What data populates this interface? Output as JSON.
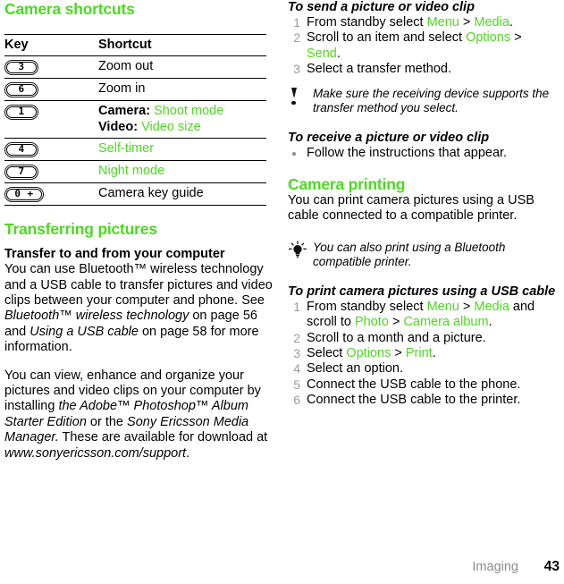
{
  "accent_color": "#4cd920",
  "left": {
    "section_title": "Camera shortcuts",
    "table": {
      "headers": [
        "Key",
        "Shortcut"
      ],
      "rows": [
        {
          "key": "3",
          "shortcut_plain": "Zoom out"
        },
        {
          "key": "6",
          "shortcut_plain": "Zoom in"
        },
        {
          "key": "1",
          "line1_label": "Camera:",
          "line1_value": "Shoot mode",
          "line2_label": "Video:",
          "line2_value": "Video size"
        },
        {
          "key": "4",
          "shortcut_green": "Self-timer"
        },
        {
          "key": "7",
          "shortcut_green": "Night mode"
        },
        {
          "key": "0 +",
          "shortcut_plain": "Camera key guide"
        }
      ]
    },
    "transferring": {
      "section_title": "Transferring pictures",
      "subheading": "Transfer to and from your computer",
      "para1_a": "You can use Bluetooth™ wireless technology and a USB cable to transfer pictures and video clips between your computer and phone. See ",
      "para1_ital1": "Bluetooth™ wireless technology",
      "para1_b": " on page 56 and ",
      "para1_ital2": "Using a USB cable",
      "para1_c": " on page 58 for more information.",
      "para2_a": "You can view, enhance and organize your pictures and video clips on your computer by installing ",
      "para2_ital1": "the Adobe™ Photoshop™ Album Starter Edition",
      "para2_b": " or the ",
      "para2_ital2": "Sony Ericsson Media Manager.",
      "para2_c": " These are available for download at ",
      "para2_ital3": "www.sonyericsson.com/support",
      "para2_d": "."
    }
  },
  "right": {
    "send_procedure": {
      "heading": "To send a picture or video clip",
      "steps": [
        {
          "num": "1",
          "a": "From standby select ",
          "g1": "Menu",
          "b": " > ",
          "g2": "Media",
          "c": "."
        },
        {
          "num": "2",
          "a": "Scroll to an item and select ",
          "g1": "Options",
          "b": " > ",
          "g2": "Send",
          "c": "."
        },
        {
          "num": "3",
          "a": "Select a transfer method.",
          "g1": "",
          "b": "",
          "g2": "",
          "c": ""
        }
      ]
    },
    "note": {
      "icon": "exclamation-icon",
      "text": "Make sure the receiving device supports the transfer method you select."
    },
    "receive_procedure": {
      "heading": "To receive a picture or video clip",
      "bullets": [
        "Follow the instructions that appear."
      ]
    },
    "camera_printing": {
      "section_title": "Camera printing",
      "para": "You can print camera pictures using a USB cable connected to a compatible printer."
    },
    "tip": {
      "icon": "lightbulb-icon",
      "text": "You can also print using a Bluetooth compatible printer."
    },
    "print_procedure": {
      "heading": "To print camera pictures using a USB cable",
      "steps": [
        {
          "num": "1",
          "a": "From standby select ",
          "g1": "Menu",
          "b": " > ",
          "g2": "Media",
          "c": " and scroll to ",
          "g3": "Photo",
          "d": " > ",
          "g4": "Camera album",
          "e": "."
        },
        {
          "num": "2",
          "a": "Scroll to a month and a picture.",
          "g1": "",
          "b": "",
          "g2": "",
          "c": "",
          "g3": "",
          "d": "",
          "g4": "",
          "e": ""
        },
        {
          "num": "3",
          "a": "Select ",
          "g1": "Options",
          "b": " > ",
          "g2": "Print",
          "c": ".",
          "g3": "",
          "d": "",
          "g4": "",
          "e": ""
        },
        {
          "num": "4",
          "a": "Select an option.",
          "g1": "",
          "b": "",
          "g2": "",
          "c": "",
          "g3": "",
          "d": "",
          "g4": "",
          "e": ""
        },
        {
          "num": "5",
          "a": "Connect the USB cable to the phone.",
          "g1": "",
          "b": "",
          "g2": "",
          "c": "",
          "g3": "",
          "d": "",
          "g4": "",
          "e": ""
        },
        {
          "num": "6",
          "a": "Connect the USB cable to the printer.",
          "g1": "",
          "b": "",
          "g2": "",
          "c": "",
          "g3": "",
          "d": "",
          "g4": "",
          "e": ""
        }
      ]
    }
  },
  "footer": {
    "chapter": "Imaging",
    "page_number": "43"
  }
}
